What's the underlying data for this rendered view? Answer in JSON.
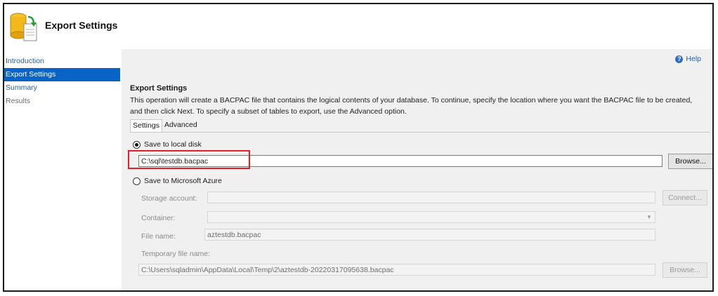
{
  "header": {
    "title": "Export Settings",
    "icon": "database-export-icon"
  },
  "sidebar": {
    "items": [
      {
        "label": "Introduction",
        "state": "link"
      },
      {
        "label": "Export Settings",
        "state": "selected"
      },
      {
        "label": "Summary",
        "state": "link"
      },
      {
        "label": "Results",
        "state": "disabled"
      }
    ]
  },
  "main": {
    "help_label": "Help",
    "section_title": "Export Settings",
    "description": "This operation will create a BACPAC file that contains the logical contents of your database. To continue, specify the location where you want the BACPAC file to be created, and then click Next. To specify a subset of tables to export, use the Advanced option.",
    "tabs": [
      {
        "label": "Settings",
        "active": true
      },
      {
        "label": "Advanced",
        "active": false
      }
    ],
    "local_disk": {
      "label": "Save to local disk",
      "checked": true,
      "path_value": "C:\\sql\\testdb.bacpac",
      "browse_label": "Browse..."
    },
    "azure": {
      "label": "Save to Microsoft Azure",
      "checked": false,
      "storage_account_label": "Storage account:",
      "storage_account_value": "",
      "connect_label": "Connect...",
      "container_label": "Container:",
      "container_value": "",
      "file_name_label": "File name:",
      "file_name_value": "aztestdb.bacpac",
      "temp_file_label": "Temporary file name:",
      "temp_file_value": "C:\\Users\\sqladmin\\AppData\\Local\\Temp\\2\\aztestdb-20220317095638.bacpac",
      "browse_label": "Browse..."
    }
  },
  "colors": {
    "accent": "#0a64c8",
    "highlight": "#e0202a",
    "panel_bg": "#f0f0f0"
  }
}
